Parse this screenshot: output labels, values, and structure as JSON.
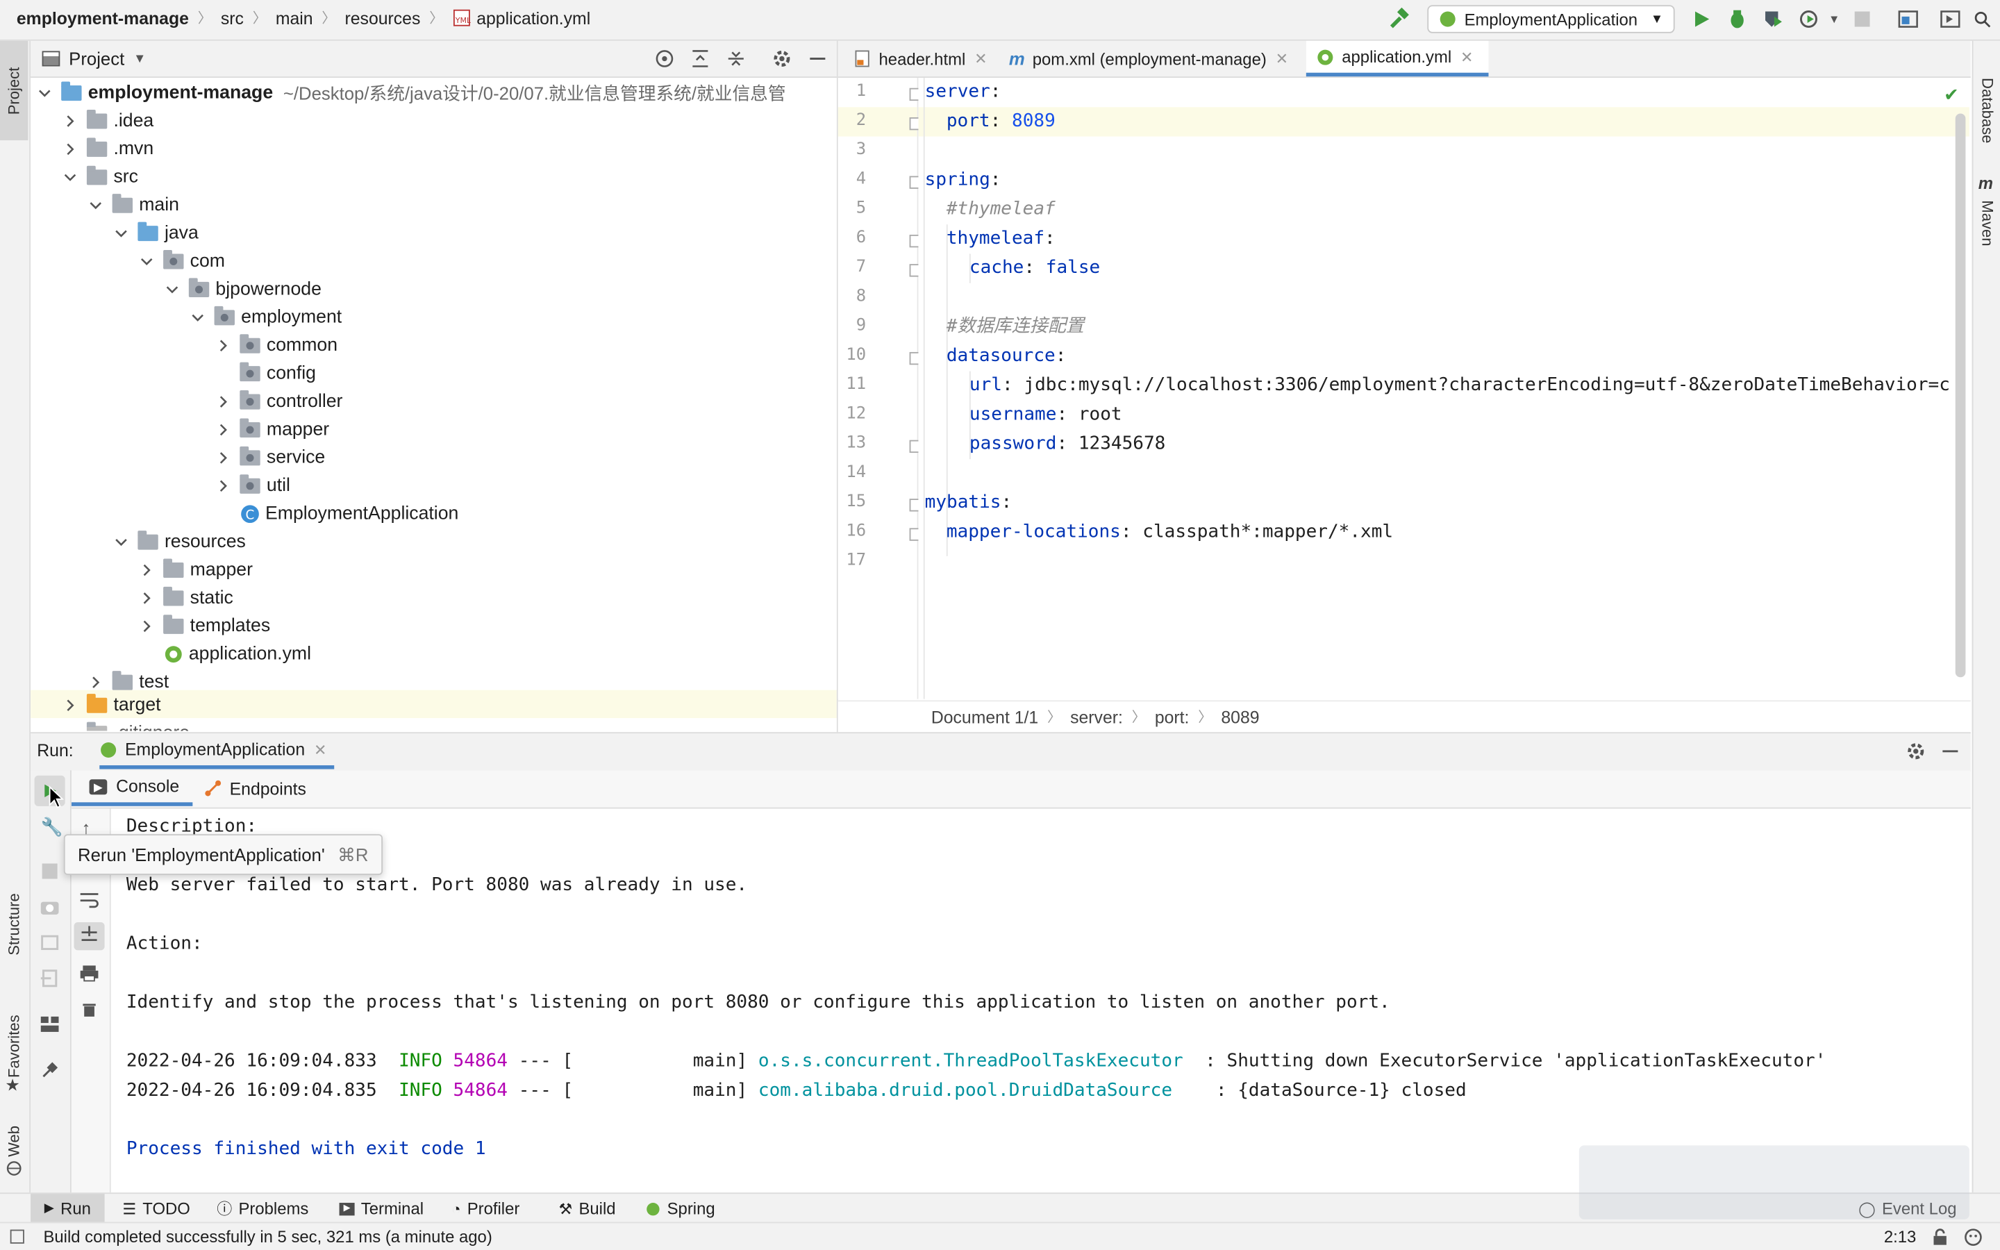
{
  "nav": {
    "breadcrumbs": [
      "employment-manage",
      "src",
      "main",
      "resources",
      "application.yml"
    ],
    "run_config": "EmploymentApplication"
  },
  "left_stripe": {
    "project": "Project",
    "structure": "Structure",
    "favorites": "Favorites",
    "web": "Web"
  },
  "right_stripe": {
    "database": "Database",
    "maven": "Maven"
  },
  "project_panel": {
    "title": "Project",
    "root_name": "employment-manage",
    "root_path": "~/Desktop/系统/java设计/0-20/07.就业信息管理系统/就业信息管",
    "nodes": {
      "idea": ".idea",
      "mvn": ".mvn",
      "src": "src",
      "main": "main",
      "java": "java",
      "com": "com",
      "bjpowernode": "bjpowernode",
      "employment": "employment",
      "common": "common",
      "config": "config",
      "controller": "controller",
      "mapper": "mapper",
      "service": "service",
      "util": "util",
      "employment_app": "EmploymentApplication",
      "resources": "resources",
      "res_mapper": "mapper",
      "static": "static",
      "templates": "templates",
      "application_yml": "application.yml",
      "test": "test",
      "target": "target",
      "gitignore": ".gitignore"
    }
  },
  "editor": {
    "tabs": {
      "header": "header.html",
      "pom": "pom.xml (employment-manage)",
      "app": "application.yml"
    },
    "line_numbers": [
      "1",
      "2",
      "3",
      "4",
      "5",
      "6",
      "7",
      "8",
      "9",
      "10",
      "11",
      "12",
      "13",
      "14",
      "15",
      "16",
      "17"
    ],
    "code": {
      "l1_key": "server",
      "l2_key": "port",
      "l2_val": "8089",
      "l4_key": "spring",
      "l5_cmt": "#thymeleaf",
      "l6_key": "thymeleaf",
      "l7_key": "cache",
      "l7_val": "false",
      "l9_cmt": "#数据库连接配置",
      "l10_key": "datasource",
      "l11_key": "url",
      "l11_val": "jdbc:mysql://localhost:3306/employment?characterEncoding=utf-8&zeroDateTimeBehavior=c",
      "l12_key": "username",
      "l12_val": "root",
      "l13_key": "password",
      "l13_val": "12345678",
      "l15_key": "mybatis",
      "l16_key": "mapper-locations",
      "l16_val": "classpath*:mapper/*.xml"
    },
    "breadcrumb": {
      "doc": "Document 1/1",
      "server": "server:",
      "port": "port:",
      "value": "8089"
    }
  },
  "run_panel": {
    "label": "Run:",
    "config_tab": "EmploymentApplication",
    "tabs": {
      "console": "Console",
      "endpoints": "Endpoints"
    },
    "tooltip": {
      "text": "Rerun 'EmploymentApplication'",
      "shortcut": "⌘R"
    },
    "console": {
      "description": "Description:",
      "error": "Web server failed to start. Port 8080 was already in use.",
      "action": "Action:",
      "identify": "Identify and stop the process that's listening on port 8080 or configure this application to listen on another port.",
      "log1": {
        "time": "2022-04-26 16:09:04.833",
        "level": "INFO",
        "pid": "54864",
        "sep": "--- [           main]",
        "cls": "o.s.s.concurrent.ThreadPoolTaskExecutor",
        "msg": ": Shutting down ExecutorService 'applicationTaskExecutor'"
      },
      "log2": {
        "time": "2022-04-26 16:09:04.835",
        "level": "INFO",
        "pid": "54864",
        "sep": "--- [           main]",
        "cls": "com.alibaba.druid.pool.DruidDataSource",
        "msg": ": {dataSource-1} closed"
      },
      "exit": "Process finished with exit code 1"
    }
  },
  "bottom_tabs": {
    "run": "Run",
    "todo": "TODO",
    "problems": "Problems",
    "terminal": "Terminal",
    "profiler": "Profiler",
    "build": "Build",
    "spring": "Spring",
    "event_log": "Event Log"
  },
  "status": {
    "message": "Build completed successfully in 5 sec, 321 ms (a minute ago)",
    "position": "2:13"
  },
  "colors": {
    "accent": "#4a86c8",
    "run_green": "#3f9b3f",
    "error_red": "#d9534f"
  }
}
